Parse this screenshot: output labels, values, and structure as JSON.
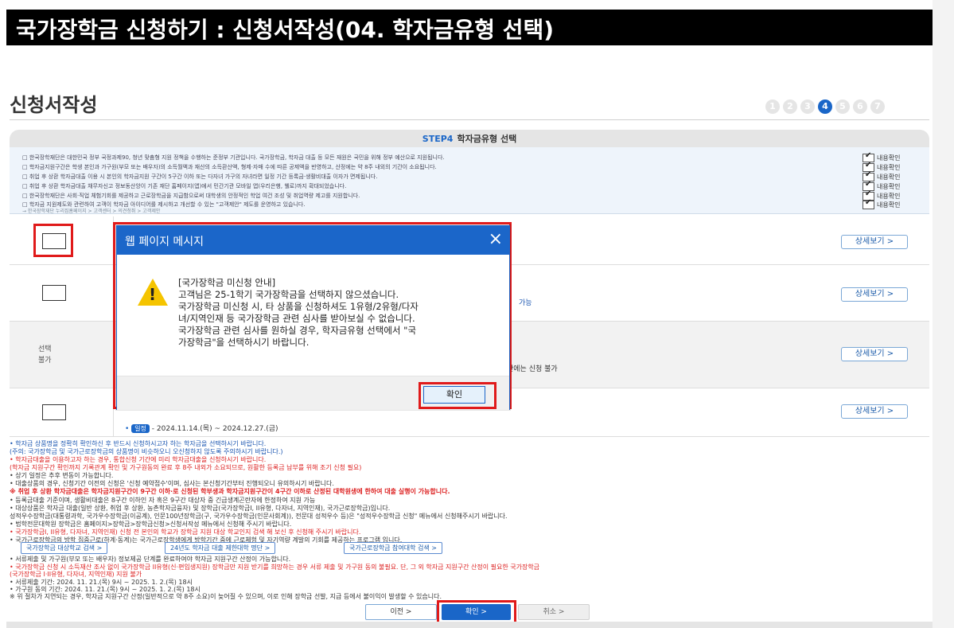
{
  "page_title": "국가장학금 신청하기 : 신청서작성(04. 학자금유형 선택)",
  "section_title": "신청서작성",
  "steps": [
    {
      "label": "1",
      "active": false
    },
    {
      "label": "2",
      "active": false
    },
    {
      "label": "3",
      "active": false
    },
    {
      "label": "4",
      "active": true
    },
    {
      "label": "5",
      "active": false
    },
    {
      "label": "6",
      "active": false
    },
    {
      "label": "7",
      "active": false
    }
  ],
  "step_header": {
    "step": "STEP4",
    "label": "학자금유형 선택"
  },
  "notice_lines": [
    "□ 한국장학재단은 대한민국 정부 국정과제90, 청년 맞춤형 지원 정책을 수행하는 준정부 기관입니다. 국가장학금, 학자금 대출 등 모든 재원은 국민을 위해 정부 예산으로 지원됩니다.",
    "□ 학자금지원구간은 학생 본인과 가구원(부모 또는 배우자)의 소득월액과 재산의 소득환산액, 형제·자매 수에 따른 공제액을 반영하고, 산정에는 약 8주 내외의 기간이 소요됩니다.",
    "□ 취업 후 상환 학자금대출 이용 시 본인의 학자금지원 구간이 5구간 이하 또는 다자녀 가구의 자녀라면 일정 기간 등록금·생활비대출 이자가 면제됩니다.",
    "□ 취업 후 상환 학자금대출 채무자신고 정보동산앙이 기존 재단 홈페이지(앱)에서 민간기관 모바일 앱(우리은행, 웰로)까지 확대되었습니다.",
    "□ 한국장학재단은 사회·직업 체험기회를 제공하고 근로장학금을 지급함으로써 대학생의 안정적인 학업 여건 조성 및 취업역량 제고를 지원합니다.",
    "□ 학자금 지원제도와 관련하여 고객이 학자금 아이디어를 제시하고 개선할 수 있는 \"고객제안\" 제도를 운영하고 있습니다.",
    "→ 한국장학재단 누리집홈페이지 > 고객센터 > 의견청취 > 고객제안"
  ],
  "notice_check_label": "내용확인",
  "products": {
    "detail_label": "상세보기 >",
    "not_selectable": [
      "선택",
      "불가"
    ],
    "row2_tail": "가능",
    "row3_tail": "간에는 신청 불가",
    "schedule_tag": "일정",
    "schedule_text": "- 2024.11.14.(목) ~ 2024.12.27.(금)"
  },
  "dialog": {
    "title": "웹 페이지 메시지",
    "close_icon": "×",
    "message_lines": [
      "[국가장학금 미신청 안내]",
      "고객님은 25-1학기 국가장학금을 선택하지 않으셨습니다.",
      "국가장학금 미신청 시, 타 상품을 신청하셔도 1유형/2유형/다자",
      "녀/지역인재 등 국가장학금 관련 심사를 받아보실 수 없습니다.",
      "국가장학금 관련 심사를 원하실 경우, 학자금유형 선택에서 \"국",
      "가장학금\"을 선택하시기 바랍니다."
    ],
    "ok_label": "확인"
  },
  "bullets": [
    {
      "text": "• 학자금 상품명을 정확히 확인하신 후 반드시 신청하시고자 하는 학자금을 선택하시기 바랍니다.",
      "color": "blue"
    },
    {
      "text": "  (주의: 국가장학금 및 국가근로장학금의 상품명이 비슷하오니 오신청하지 않도록 주의하시기 바랍니다.)",
      "color": "blue"
    },
    {
      "text": "• 학자금대출을 이용하고자 하는 경우, 통합신청 기간에 미리 학자금대출을 신청하시기 바랍니다.",
      "color": "red"
    },
    {
      "text": "  (학자금 지원구간 확인까지 기록관계 확인 및 가구원동의 완료 후 8주 내외가 소요되므로, 원활한 등록금 납부를 위해 조기 신청 필요)",
      "color": "red"
    },
    {
      "text": "• 상기 일정은 추후 변동이 가능합니다.",
      "color": "dark"
    },
    {
      "text": "• 대출상품의 경우, 신청기간 이전의 신청은 '신청 예약접수'이며, 심사는 본신청기간부터 진행되오니 유의하시기 바랍니다.",
      "color": "dark"
    },
    {
      "text": "※ 취업 후 상환 학자금대출은 학자금지원구간이 9구간 이하·로 신청된 학부생과 학자금지원구간이 4구간 이하로 산정된 대학원생에 한하여 대출 실행이 가능합니다.",
      "color": "red-bold"
    },
    {
      "text": "  • 등록금대출 기준이며, 생활비대출은 8구간 이하인 자 혹은 9구간 대상자 중 긴급생계곤란자에 한정하여 지원 가능",
      "color": "dark"
    },
    {
      "text": "• 대상상품은 학자금 대출(일반 상환, 취업 후 상환, 농촌학자금융자) 및 장학금(국가장학금I, II유형, 다자녀, 지역인재), 국가근로장학금)입니다.",
      "color": "dark"
    },
    {
      "text": "  성적우수장학금(대통령과학, 국가우수장학금(이공계), 인문100년장학금(구, 국가우수장학금(인문사회계)), 전문대 성적우수 등)은 \"성적우수장학금 신청\" 메뉴에서 신청해주시기 바랍니다.",
      "color": "dark"
    },
    {
      "text": "• 법학전문대학원 장학금은 홈페이지>장학금>장학금신청>신청서작성 메뉴에서 신청해 주시기 바랍니다.",
      "color": "dark"
    },
    {
      "text": "• 국가장학금I, II유형, 다자녀, 지역인재) 신청 전 본인의 학교가 장학금 지원 대상 학교인지 검색 해 보신 후 신청해 주시기 바랍니다.",
      "color": "red"
    },
    {
      "text": "• 국가근로장학금의 방학 집중근로(하계·동계)는 국가근로장학생에게 방학기간 중에 근로체험 및 자기역량 계발의 기회를 제공하는 프로그램 입니다.",
      "color": "dark"
    }
  ],
  "search_buttons": [
    "국가장학금 대상학교 검색 >",
    "24년도 학자금 대출 제한대학 명단 >",
    "국가근로장학금 참여대학 검색 >"
  ],
  "bullets2": [
    {
      "text": "• 서류제출 및 가구원(부모 또는 배우자) 정보제공 단계를 완료하여야 학자금 지원구간 산정이 가능합니다.",
      "color": "dark"
    },
    {
      "text": "• 국가장학금 신청 시 소득재산 조사 없이 국가장학금 II유형(신·편입생지원) 장학금만 지원 받기를 희망하는 경우 서류 제출 및 가구원 동의 불필요. 단, 그 외 학자금 지원구간 산정이 필요한 국가장학금",
      "color": "red"
    },
    {
      "text": "  (국가장학금 I·II유형, 다자녀, 지역인재) 지원 불가",
      "color": "red"
    },
    {
      "text": "• 서류제출 기간: 2024. 11. 21.(목) 9시 ~ 2025. 1. 2.(목) 18시",
      "color": "dark"
    },
    {
      "text": "• 가구원 동의 기간: 2024. 11. 21.(목) 9시 ~ 2025. 1. 2.(목) 18시",
      "color": "dark"
    },
    {
      "text": "※ 위 절차가 지연되는 경우, 학자금 지원구간 산정(일반적으로 약 8주 소요)이 늦어질 수 있으며, 이로 인해 장학금 선발, 지급 등에서 불이익이 발생할 수 있습니다.",
      "color": "dark"
    }
  ],
  "bottom_buttons": {
    "prev": "이전  >",
    "confirm": "확인  >",
    "cancel": "취소  >"
  },
  "colors": {
    "accent": "#1b66c9",
    "highlight": "#e01a1a",
    "title_bar": "#000000"
  }
}
